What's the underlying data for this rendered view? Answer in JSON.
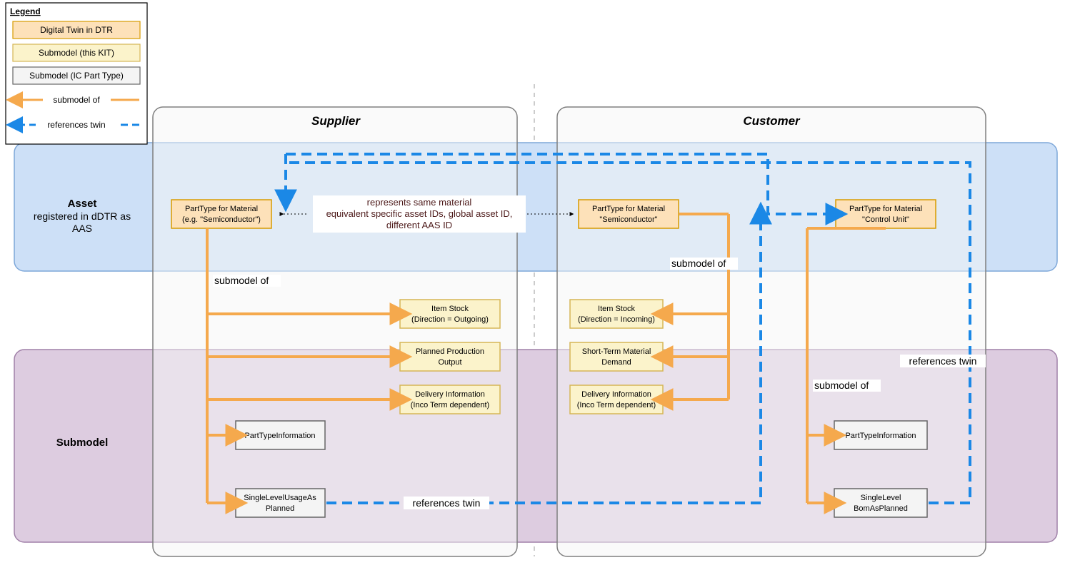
{
  "legend": {
    "title": "Legend",
    "items": {
      "dtr": "Digital Twin in DTR",
      "submodel_kit": "Submodel (this KIT)",
      "submodel_ic": "Submodel (IC Part Type)",
      "submodel_of": "submodel of",
      "references_twin": "references twin"
    }
  },
  "columns": {
    "supplier": "Supplier",
    "customer": "Customer"
  },
  "rows": {
    "asset_title": "Asset",
    "asset_sub1": "registered in dDTR as",
    "asset_sub2": "AAS",
    "submodel_title": "Submodel"
  },
  "nodes": {
    "supplier_parttype": {
      "l1": "PartType for Material",
      "l2": "(e.g. \"Semiconductor\")"
    },
    "customer_semiconductor": {
      "l1": "PartType for Material",
      "l2": "\"Semiconductor\""
    },
    "customer_control_unit": {
      "l1": "PartType for Material",
      "l2": "\"Control Unit\""
    },
    "supplier_item_stock": {
      "l1": "Item Stock",
      "l2": "(Direction = Outgoing)"
    },
    "supplier_ppo": {
      "l1": "Planned Production",
      "l2": "Output"
    },
    "supplier_delivery": {
      "l1": "Delivery Information",
      "l2": "(Inco Term dependent)"
    },
    "supplier_pti": "PartTypeInformation",
    "supplier_slu": {
      "l1": "SingleLevelUsageAs",
      "l2": "Planned"
    },
    "customer_item_stock": {
      "l1": "Item Stock",
      "l2": "(Direction = Incoming)"
    },
    "customer_stmd": {
      "l1": "Short-Term Material",
      "l2": "Demand"
    },
    "customer_delivery": {
      "l1": "Delivery Information",
      "l2": "(Inco Term dependent)"
    },
    "customer_pti": "PartTypeInformation",
    "customer_slb": {
      "l1": "SingleLevel",
      "l2": "BomAsPlanned"
    }
  },
  "labels": {
    "submodel_of": "submodel of",
    "references_twin": "references twin",
    "same_material_l1": "represents same material",
    "same_material_l2": "equivalent specific asset IDs, global asset ID,",
    "same_material_l3": "different AAS ID"
  },
  "colors": {
    "orange_fill": "#fde1b9",
    "orange_stroke": "#d79b00",
    "yellow_fill": "#fbf3cb",
    "yellow_stroke": "#d6b656",
    "grey_fill": "#f4f4f4",
    "grey_stroke": "#666666",
    "orange_line": "#f5a94d",
    "blue_line": "#1b88e6",
    "blue_band": "#cde0f7",
    "purple_band": "#ddcce0",
    "container_fill": "#f5f5f5",
    "container_stroke": "#7f7f7f",
    "text_dark_red": "#4d1a1a"
  }
}
